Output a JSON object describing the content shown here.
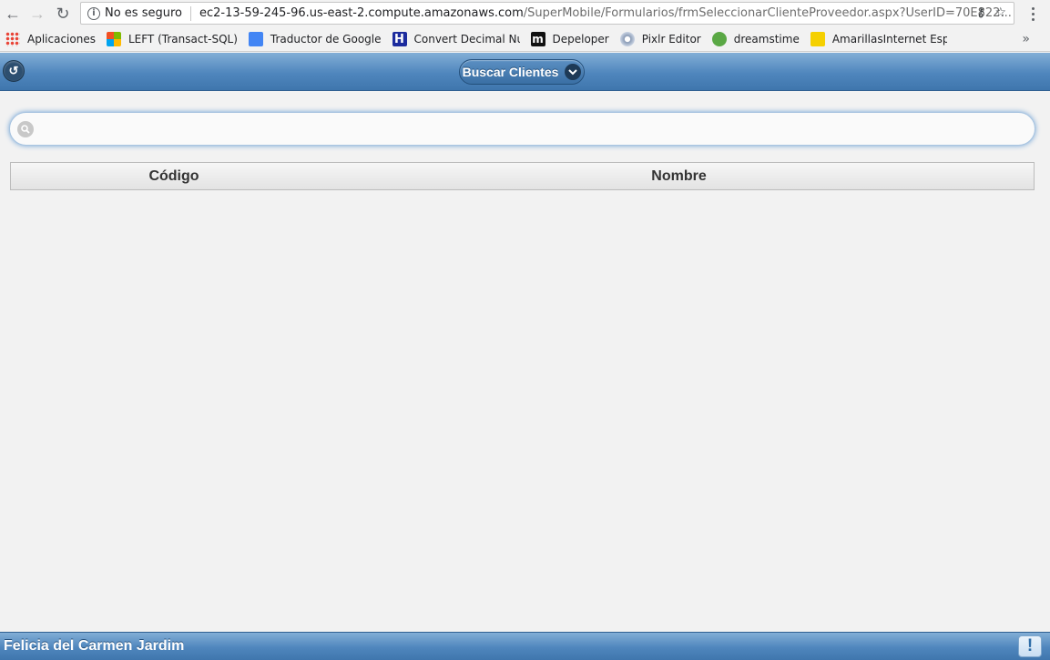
{
  "browser": {
    "security_label": "No es seguro",
    "url_host": "ec2-13-59-245-96.us-east-2.compute.amazonaws.com",
    "url_path": "/SuperMobile/Formularios/frmSeleccionarClienteProveedor.aspx?UserID=70E822...",
    "bookmarks": [
      {
        "label": "Aplicaciones",
        "icon": "apps-grid-icon"
      },
      {
        "label": "LEFT (Transact-SQL)",
        "icon": "microsoft-icon"
      },
      {
        "label": "Traductor de Google",
        "icon": "google-translate-icon"
      },
      {
        "label": "Convert Decimal Nu",
        "icon": "h-icon"
      },
      {
        "label": "Depeloper",
        "icon": "m-icon"
      },
      {
        "label": "Pixlr Editor",
        "icon": "pixlr-icon"
      },
      {
        "label": "dreamstime",
        "icon": "dreamstime-icon"
      },
      {
        "label": "AmarillasInternet Esp",
        "icon": "amarillas-icon"
      }
    ],
    "more_label": "»"
  },
  "header": {
    "title": "Buscar Clientes"
  },
  "search": {
    "value": "",
    "placeholder": ""
  },
  "table": {
    "columns": [
      "Código",
      "Nombre"
    ],
    "rows": []
  },
  "footer": {
    "user_name": "Felicia del Carmen Jardim",
    "alert_symbol": "!"
  },
  "colors": {
    "header_bar": "#4f86bd",
    "page_bg": "#f2f2f2"
  }
}
